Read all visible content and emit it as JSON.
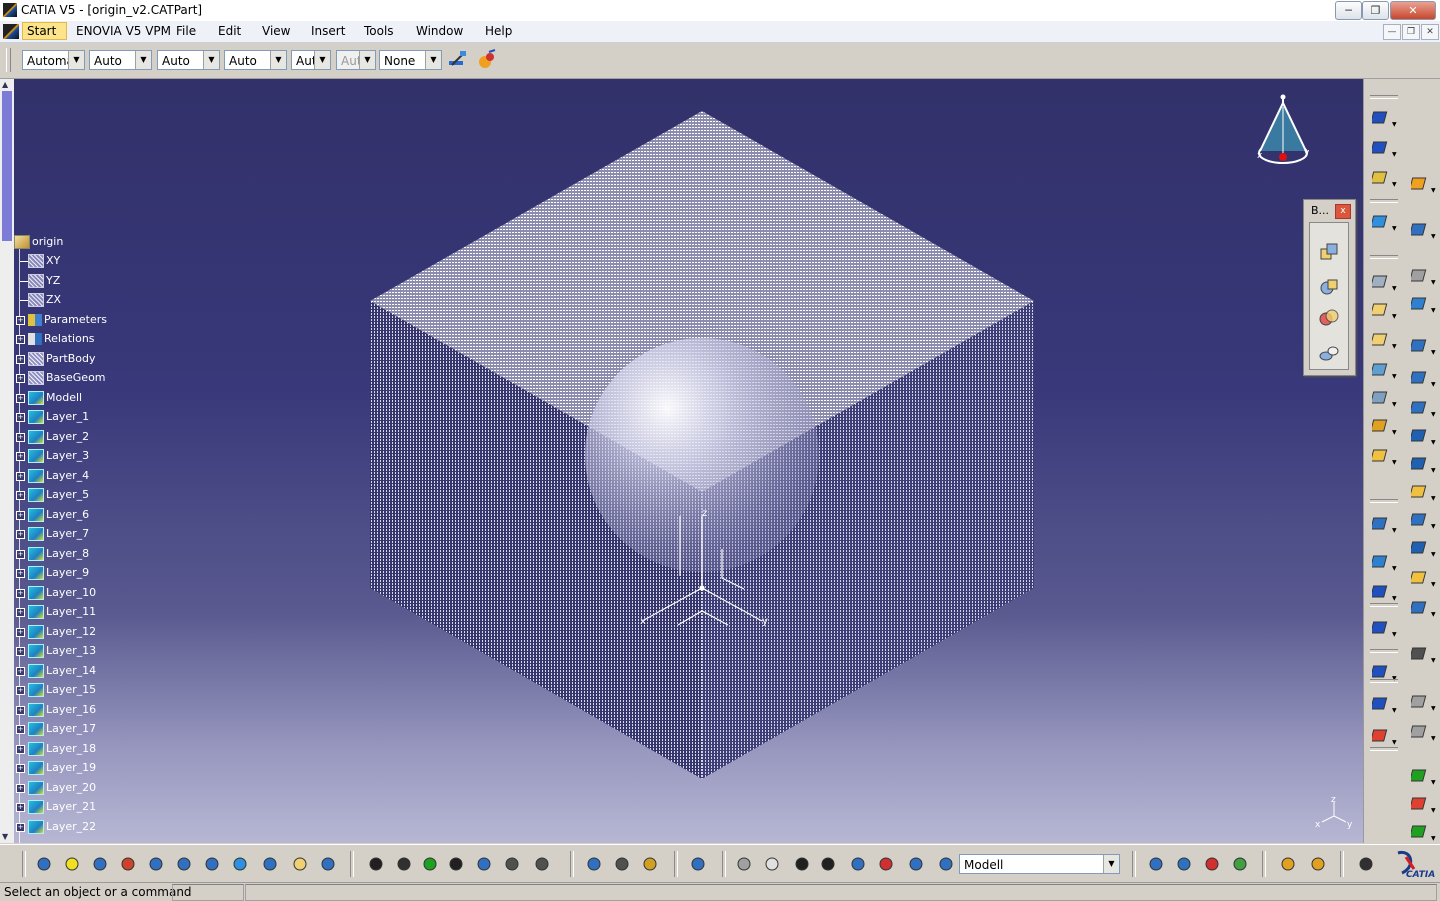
{
  "window": {
    "title": "CATIA V5 - [origin_v2.CATPart]",
    "minimize": "─",
    "restore": "❐",
    "close": "✕"
  },
  "menubar": {
    "items": [
      "Start",
      "ENOVIA V5 VPM",
      "File",
      "Edit",
      "View",
      "Insert",
      "Tools",
      "Window",
      "Help"
    ]
  },
  "toolbar": {
    "combos": [
      "Automatic",
      "Auto",
      "Auto",
      "Auto",
      "Auto",
      "Auto",
      "None"
    ]
  },
  "tree": {
    "root": "origin",
    "items": [
      "XY",
      "YZ",
      "ZX",
      "Parameters",
      "Relations",
      "PartBody",
      "BaseGeom",
      "Modell",
      "Layer_1",
      "Layer_2",
      "Layer_3",
      "Layer_4",
      "Layer_5",
      "Layer_6",
      "Layer_7",
      "Layer_8",
      "Layer_9",
      "Layer_10",
      "Layer_11",
      "Layer_12",
      "Layer_13",
      "Layer_14",
      "Layer_15",
      "Layer_16",
      "Layer_17",
      "Layer_18",
      "Layer_19",
      "Layer_20",
      "Layer_21",
      "Layer_22"
    ]
  },
  "floating_toolbar": {
    "title": "B...",
    "close": "x"
  },
  "compass": {
    "axes": [
      "x",
      "y",
      "z"
    ]
  },
  "bottom_toolbar": {
    "current_body": "Modell"
  },
  "status": {
    "message": "Select an object or a command"
  },
  "colors": {
    "viewport_top": "#32316a",
    "viewport_bottom": "#b7b7d4",
    "tree_text": "#ffffff",
    "start_highlight": "#fbe48a"
  }
}
